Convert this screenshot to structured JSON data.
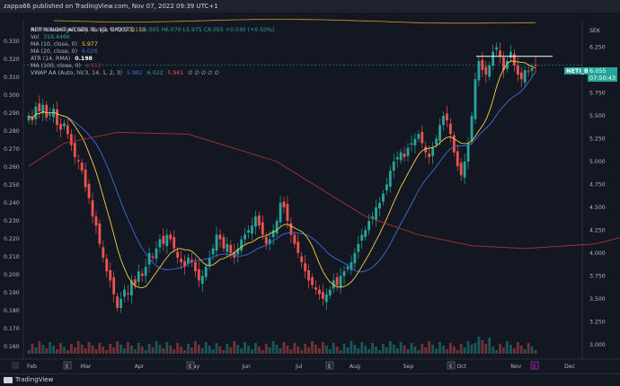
{
  "header": {
    "publish_line": "zappa66 published on TradingView.com, Nov 07, 2022 09:39 UTC+1"
  },
  "footer": {
    "brand": "TradingView"
  },
  "indicators": {
    "adr": {
      "label": "ADR%",
      "name": "Average Daily Range % (21)",
      "value": "3.158"
    },
    "symbol": {
      "label": "NET INSIGHT AB SER. B, 1D, OMXSTO",
      "ohlc": "O6.005  H6.070  L5.975  C6.055  +0.030 (+0.50%)"
    },
    "vol": {
      "label": "Vol",
      "value": "316.446K"
    },
    "ma10": {
      "label": "MA (10, close, 0)",
      "value": "5.977"
    },
    "ma20": {
      "label": "MA (20, close, 0)",
      "value": "6.026"
    },
    "atr": {
      "label": "ATR (14, RMA)",
      "value": "0.198"
    },
    "ma100": {
      "label": "MA (100, close, 0)",
      "value": "4.912"
    },
    "vwap": {
      "label": "VWAP AA (Auto, hlc3, 14, 1, 2, 3)",
      "v1": "5.982",
      "v2": "6.022",
      "v3": "5.941",
      "rest": "∅  ∅  ∅  ∅  ∅"
    }
  },
  "price_tags": {
    "symbol_tag": "NETI_B",
    "last_price": "6.055",
    "countdown": "07:50:43"
  },
  "colors": {
    "up": "#26a69a",
    "down": "#ef5350",
    "ma10": "#f5d142",
    "ma20": "#3d6ed8",
    "ma100": "#a83232",
    "adr": "#d89a2c",
    "vwap": "#e0e0e0"
  },
  "chart_data": {
    "type": "candlestick",
    "left_axis": {
      "ticks": [
        "0.330",
        "0.320",
        "0.310",
        "0.300",
        "0.290",
        "0.280",
        "0.270",
        "0.260",
        "0.250",
        "0.240",
        "0.230",
        "0.220",
        "0.210",
        "0.200",
        "0.190",
        "0.180",
        "0.170",
        "0.160"
      ]
    },
    "right_axis": {
      "currency": "SEK",
      "ticks": [
        "6.250",
        "6.000",
        "5.750",
        "5.500",
        "5.250",
        "5.000",
        "4.750",
        "4.500",
        "4.250",
        "4.000",
        "3.750",
        "3.500",
        "3.250",
        "3.000"
      ],
      "range": [
        2.9,
        6.55
      ]
    },
    "x_axis": {
      "ticks": [
        "Feb",
        "Mar",
        "Apr",
        "May",
        "Jun",
        "Jul",
        "Aug",
        "Sep",
        "Oct",
        "Nov",
        "Dec"
      ]
    },
    "event_markers": [
      "E",
      "E",
      "E",
      "E",
      "E"
    ],
    "series_close": [
      5.5,
      5.45,
      5.6,
      5.55,
      5.62,
      5.48,
      5.52,
      5.58,
      5.4,
      5.35,
      5.42,
      5.3,
      5.18,
      5.05,
      5.0,
      4.9,
      4.72,
      4.6,
      4.4,
      4.3,
      4.1,
      3.95,
      3.8,
      3.7,
      3.55,
      3.4,
      3.5,
      3.6,
      3.55,
      3.7,
      3.65,
      3.8,
      3.75,
      3.85,
      4.0,
      3.95,
      4.05,
      4.15,
      4.1,
      4.2,
      4.15,
      4.05,
      3.95,
      3.9,
      3.85,
      3.95,
      3.9,
      3.8,
      3.7,
      3.75,
      3.85,
      3.95,
      4.05,
      4.2,
      4.15,
      4.05,
      4.1,
      4.0,
      3.95,
      4.05,
      4.15,
      4.2,
      4.25,
      4.3,
      4.4,
      4.3,
      4.2,
      4.1,
      4.15,
      4.25,
      4.35,
      4.55,
      4.5,
      4.35,
      4.2,
      4.1,
      4.0,
      3.9,
      3.8,
      3.7,
      3.65,
      3.6,
      3.55,
      3.5,
      3.55,
      3.6,
      3.7,
      3.65,
      3.75,
      3.8,
      3.85,
      3.9,
      4.0,
      4.1,
      4.2,
      4.25,
      4.35,
      4.4,
      4.5,
      4.55,
      4.65,
      4.75,
      4.9,
      5.0,
      5.05,
      5.1,
      5.05,
      5.15,
      5.2,
      5.25,
      5.3,
      5.2,
      5.1,
      5.05,
      5.15,
      5.25,
      5.4,
      5.5,
      5.45,
      5.3,
      5.1,
      4.95,
      4.85,
      5.0,
      5.2,
      5.5,
      5.9,
      6.1,
      6.0,
      5.95,
      6.05,
      6.2,
      6.25,
      6.15,
      6.0,
      6.1,
      6.2,
      6.05,
      5.95,
      5.9,
      6.0,
      5.98,
      6.02,
      6.055
    ],
    "ma100_points": [
      [
        0,
        4.95
      ],
      [
        10,
        5.2
      ],
      [
        25,
        5.32
      ],
      [
        45,
        5.3
      ],
      [
        70,
        5.0
      ],
      [
        95,
        4.4
      ],
      [
        110,
        4.2
      ],
      [
        125,
        4.08
      ],
      [
        140,
        4.05
      ],
      [
        160,
        4.1
      ],
      [
        180,
        4.3
      ],
      [
        200,
        4.55
      ],
      [
        220,
        4.8
      ],
      [
        235,
        4.95
      ]
    ]
  }
}
